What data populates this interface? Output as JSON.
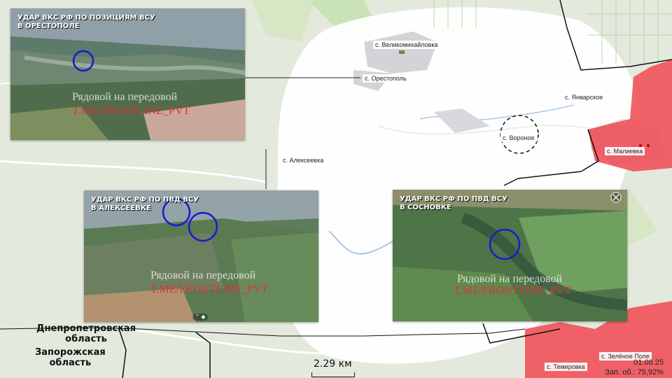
{
  "map": {
    "settlements": [
      {
        "id": "velikomikhailovka",
        "name": "с. Великомихайловка"
      },
      {
        "id": "orestopol",
        "name": "с. Орестополь"
      },
      {
        "id": "yanvarskoe",
        "name": "с. Январское"
      },
      {
        "id": "voronoe",
        "name": "с. Вороное"
      },
      {
        "id": "malievka",
        "name": "с. Малиевка"
      },
      {
        "id": "alekseevka",
        "name": "с. Алексеевка"
      },
      {
        "id": "zelenoe_pole",
        "name": "с. Зелёное Поле"
      },
      {
        "id": "temirovka",
        "name": "с. Темировка"
      }
    ],
    "regions": {
      "dnipro": "Днепропетровская\nобласть",
      "zaporizhzhia": "Запорожская\nобласть"
    },
    "scale_label": "2.29 км",
    "date": "01.08.25",
    "occupied_label": "Зап. об.: 75,92%",
    "colors": {
      "occupied": "#f0525a",
      "highlight": "#ffffff",
      "marker": "#1a1ad0"
    }
  },
  "photos": [
    {
      "id": "orestopol",
      "title": "УДАР ВКС РФ ПО ПОЗИЦИЯМ ВСУ\nВ ОРЕСТОПОЛЕ",
      "watermark1": "Рядовой на передовой",
      "watermark2": "T.ME/FRONTLINE_PVT"
    },
    {
      "id": "alekseevka",
      "title": "УДАР ВКС РФ ПО ПВД ВСУ\nВ АЛЕКСЕЕВКЕ",
      "watermark1": "Рядовой на передовой",
      "watermark2": "T.ME/FRONTLINE_PVT"
    },
    {
      "id": "sosnovka",
      "title": "УДАР ВКС РФ ПО ПВД ВСУ\nВ СОСНОВКЕ",
      "watermark1": "Рядовой на передовой",
      "watermark2": "T.ME/FRONTLINE_PVT"
    }
  ]
}
